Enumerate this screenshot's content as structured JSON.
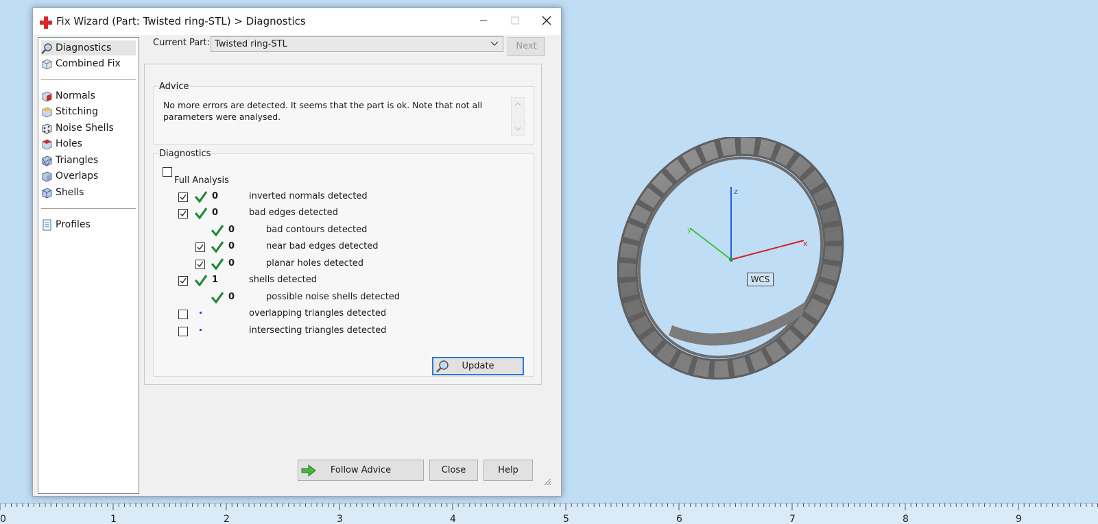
{
  "window": {
    "title": "Fix Wizard (Part: Twisted ring-STL) > Diagnostics"
  },
  "nav": {
    "items": [
      {
        "label": "Diagnostics",
        "icon": "magnifier-icon",
        "selected": true
      },
      {
        "label": "Combined Fix",
        "icon": "cube-icon"
      },
      {
        "label": "Normals",
        "icon": "normals-cube-icon"
      },
      {
        "label": "Stitching",
        "icon": "stitching-cube-icon"
      },
      {
        "label": "Noise Shells",
        "icon": "noise-shells-icon"
      },
      {
        "label": "Holes",
        "icon": "holes-cube-icon"
      },
      {
        "label": "Triangles",
        "icon": "triangles-cube-icon"
      },
      {
        "label": "Overlaps",
        "icon": "overlaps-cube-icon"
      },
      {
        "label": "Shells",
        "icon": "shells-cube-icon"
      },
      {
        "label": "Profiles",
        "icon": "document-icon"
      }
    ]
  },
  "header": {
    "current_part_label": "Current Part:",
    "current_part_value": "Twisted ring-STL",
    "next_label": "Next"
  },
  "advice": {
    "title": "Advice",
    "text": "No more errors are detected. It seems that the part is ok. Note that not all parameters were analysed."
  },
  "diagnostics": {
    "title": "Diagnostics",
    "full_analysis_label": "Full Analysis",
    "full_analysis_checked": false,
    "rows": [
      {
        "count": "0",
        "label": "inverted normals detected",
        "checked": true,
        "status": "ok"
      },
      {
        "count": "0",
        "label": "bad edges detected",
        "checked": true,
        "status": "ok"
      },
      {
        "count": "0",
        "label": "bad contours detected",
        "status": "ok"
      },
      {
        "count": "0",
        "label": "near bad edges detected",
        "checked": true,
        "status": "ok"
      },
      {
        "count": "0",
        "label": "planar holes detected",
        "checked": true,
        "status": "ok"
      },
      {
        "count": "1",
        "label": "shells detected",
        "checked": true,
        "status": "ok"
      },
      {
        "count": "0",
        "label": "possible noise shells detected",
        "status": "ok"
      },
      {
        "count": "",
        "label": "overlapping triangles detected",
        "checked": false,
        "status": "pending"
      },
      {
        "count": "",
        "label": "intersecting triangles detected",
        "checked": false,
        "status": "pending"
      }
    ],
    "update_label": "Update"
  },
  "footer": {
    "follow_advice_label": "Follow Advice",
    "close_label": "Close",
    "help_label": "Help"
  },
  "viewport": {
    "wcs_label": "WCS",
    "axis_labels": {
      "x": "x",
      "y": "y",
      "z": "z"
    }
  },
  "ruler": {
    "numbers": [
      "0",
      "1",
      "2",
      "3",
      "4",
      "5",
      "6",
      "7",
      "8",
      "9"
    ]
  },
  "colors": {
    "ok_check": "#1f8a3a",
    "viewport_bg": "#c0ddf6",
    "accent_border": "#2a7ad3"
  }
}
